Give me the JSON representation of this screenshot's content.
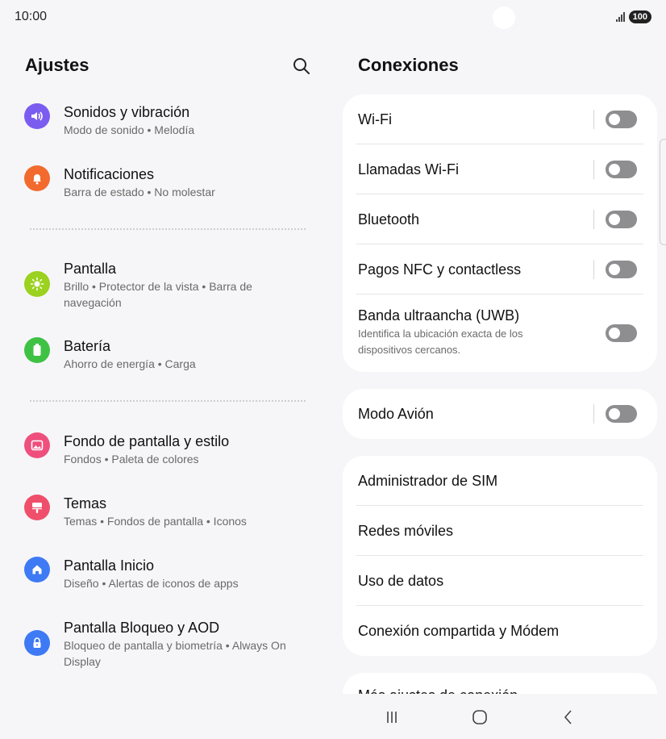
{
  "status_bar": {
    "time": "10:00",
    "battery": "100"
  },
  "left": {
    "title": "Ajustes",
    "search_icon": "search-icon",
    "items": [
      {
        "title": "Sonidos y vibración",
        "subtitle": "Modo de sonido • Melodía",
        "icon": "volume-icon",
        "color": "#7b5cf0"
      },
      {
        "title": "Notificaciones",
        "subtitle": "Barra de estado • No molestar",
        "icon": "bell-icon",
        "color": "#f26a2e"
      },
      {
        "title": "Pantalla",
        "subtitle": "Brillo • Protector de la vista • Barra de navegación",
        "icon": "brightness-icon",
        "color": "#9bd11f"
      },
      {
        "title": "Batería",
        "subtitle": "Ahorro de energía • Carga",
        "icon": "battery-icon",
        "color": "#3fc244"
      },
      {
        "title": "Fondo de pantalla y estilo",
        "subtitle": "Fondos • Paleta de colores",
        "icon": "wallpaper-icon",
        "color": "#ef4f7d"
      },
      {
        "title": "Temas",
        "subtitle": "Temas • Fondos de pantalla • Iconos",
        "icon": "paint-brush-icon",
        "color": "#ef4f6a"
      },
      {
        "title": "Pantalla Inicio",
        "subtitle": "Diseño • Alertas de iconos de apps",
        "icon": "home-icon",
        "color": "#3f7af5"
      },
      {
        "title": "Pantalla Bloqueo y AOD",
        "subtitle": "Bloqueo de pantalla y biometría • Always On Display",
        "icon": "lock-icon",
        "color": "#3f7af5"
      }
    ]
  },
  "right": {
    "title": "Conexiones",
    "group1": [
      {
        "label": "Wi-Fi",
        "toggle": "off"
      },
      {
        "label": "Llamadas Wi-Fi",
        "toggle": "off"
      },
      {
        "label": "Bluetooth",
        "toggle": "off"
      },
      {
        "label": "Pagos NFC y contactless",
        "toggle": "off"
      },
      {
        "label": "Banda ultraancha (UWB)",
        "subtitle": "Identifica la ubicación exacta de los dispositivos cercanos.",
        "toggle": "off"
      }
    ],
    "group2": [
      {
        "label": "Modo Avión",
        "toggle": "off"
      }
    ],
    "group3": [
      {
        "label": "Administrador de SIM"
      },
      {
        "label": "Redes móviles"
      },
      {
        "label": "Uso de datos"
      },
      {
        "label": "Conexión compartida y Módem"
      }
    ],
    "partial_item": "Más ajustes de conexión"
  },
  "navbar": {
    "recents": "recents-icon",
    "home": "home-nav-icon",
    "back": "back-icon"
  }
}
